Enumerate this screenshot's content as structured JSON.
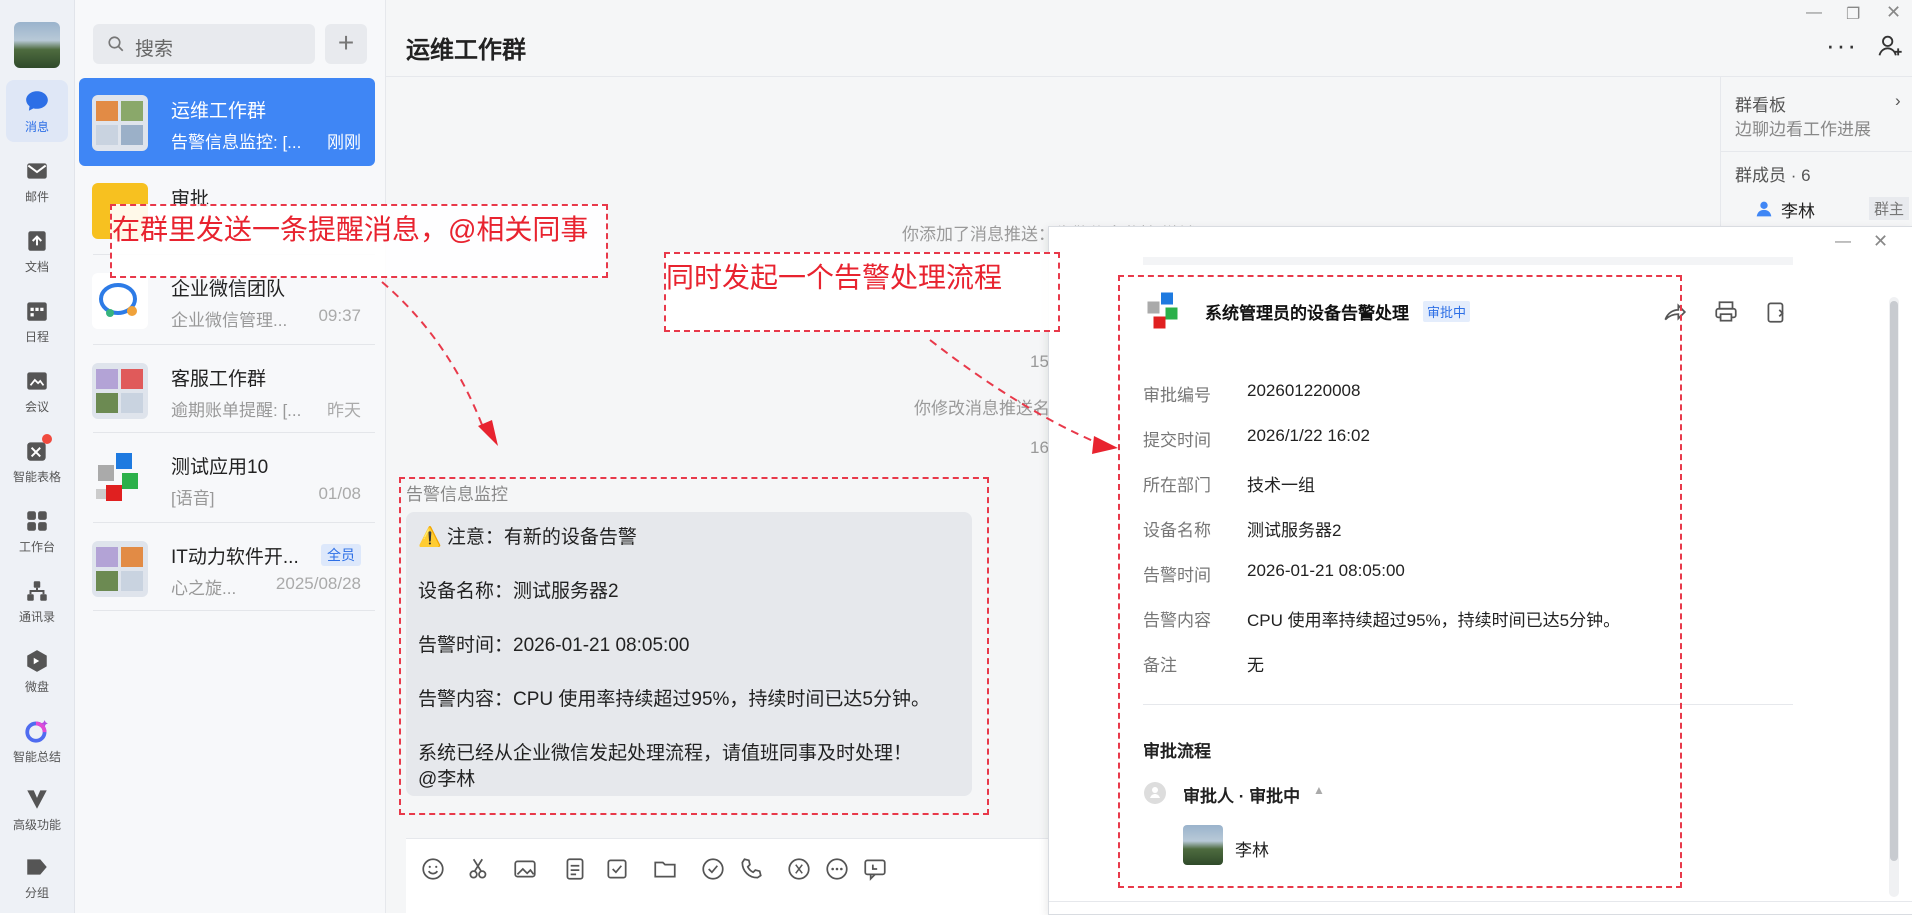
{
  "nav": {
    "items": [
      {
        "label": "消息",
        "icon": "chat-bubble-icon"
      },
      {
        "label": "邮件",
        "icon": "mail-icon"
      },
      {
        "label": "文档",
        "icon": "document-icon"
      },
      {
        "label": "日程",
        "icon": "calendar-icon"
      },
      {
        "label": "会议",
        "icon": "meeting-icon"
      },
      {
        "label": "智能表格",
        "icon": "smart-sheet-icon"
      },
      {
        "label": "工作台",
        "icon": "workbench-icon"
      },
      {
        "label": "通讯录",
        "icon": "contacts-icon"
      },
      {
        "label": "微盘",
        "icon": "drive-icon"
      },
      {
        "label": "智能总结",
        "icon": "ai-summary-icon"
      },
      {
        "label": "高级功能",
        "icon": "advanced-icon"
      },
      {
        "label": "分组",
        "icon": "tag-icon"
      }
    ]
  },
  "search": {
    "placeholder": "搜索"
  },
  "conversations": [
    {
      "name": "运维工作群",
      "preview": "告警信息监控: [...",
      "time": "刚刚"
    },
    {
      "name": "审批",
      "preview": "",
      "time": ""
    },
    {
      "name": "企业微信团队",
      "preview": "企业微信管理...",
      "time": "09:37"
    },
    {
      "name": "客服工作群",
      "preview": "逾期账单提醒: [...",
      "time": "昨天"
    },
    {
      "name": "测试应用10",
      "preview": "[语音]",
      "time": "01/08"
    },
    {
      "name": "IT动力软件开...",
      "preview": "心之旋...",
      "time": "2025/08/28",
      "badge": "全员"
    }
  ],
  "chat": {
    "title": "运维工作群",
    "system_messages": [
      {
        "text": "你添加了消息推送：告警信息监控 撤销"
      },
      {
        "text": "15"
      },
      {
        "text": "你修改消息推送名"
      },
      {
        "text": "16"
      }
    ],
    "message": {
      "sender": "告警信息监控",
      "lines": [
        "⚠️ 注意：有新的设备告警",
        "设备名称：测试服务器2",
        "告警时间：2026-01-21 08:05:00",
        "告警内容：CPU 使用率持续超过95%，持续时间已达5分钟。",
        "系统已经从企业微信发起处理流程，请值班同事及时处理！",
        " @李林"
      ]
    }
  },
  "group_panel": {
    "board_title": "群看板",
    "board_sub": "边聊边看工作进展",
    "members_label": "群成员 · 6",
    "member_name": "李林",
    "member_role": "群主"
  },
  "approval": {
    "title": "系统管理员的设备告警处理",
    "status": "审批中",
    "fields": [
      {
        "key": "审批编号",
        "value": "202601220008"
      },
      {
        "key": "提交时间",
        "value": "2026/1/22 16:02"
      },
      {
        "key": "所在部门",
        "value": "技术一组"
      },
      {
        "key": "设备名称",
        "value": "测试服务器2"
      },
      {
        "key": "告警时间",
        "value": "2026-01-21 08:05:00"
      },
      {
        "key": "告警内容",
        "value": "CPU 使用率持续超过95%，持续时间已达5分钟。"
      },
      {
        "key": "备注",
        "value": "无"
      }
    ],
    "flow_title": "审批流程",
    "flow_step": "审批人 · 审批中",
    "approver": "李林"
  },
  "annotations": {
    "left": "在群里发送一条提醒消息，@相关同事",
    "right": "同时发起一个告警处理流程"
  },
  "colors": {
    "accent": "#3f86f5",
    "annotation": "#e8232f"
  }
}
